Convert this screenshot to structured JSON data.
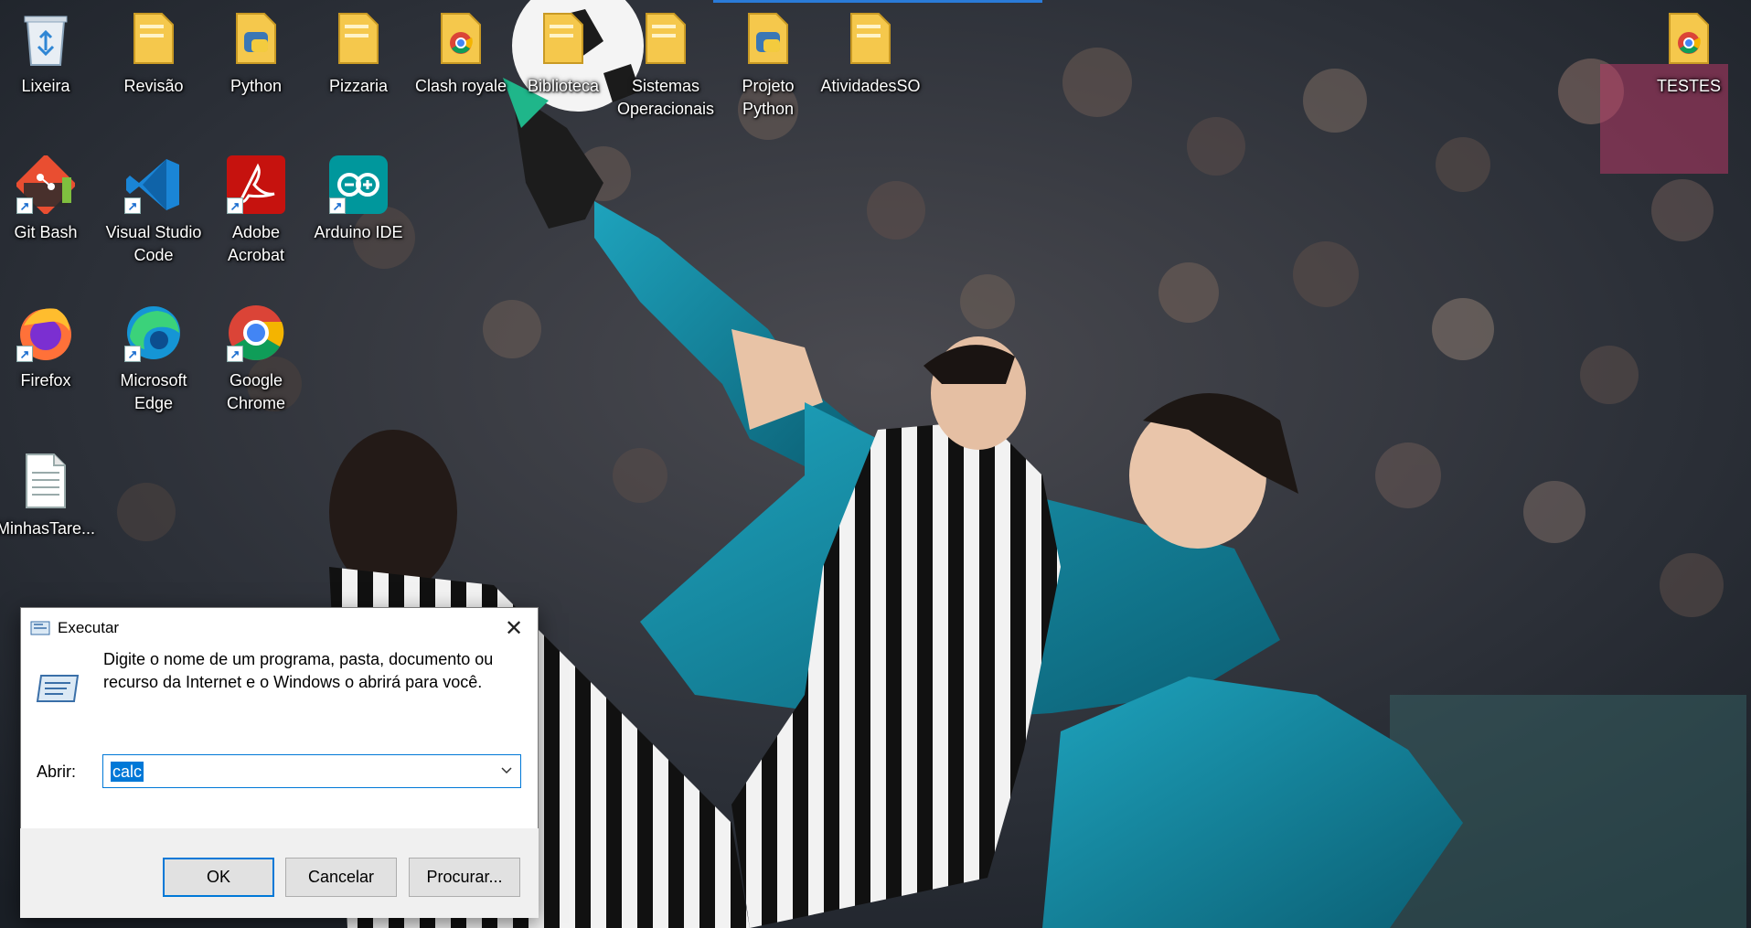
{
  "desktop": {
    "icons": [
      {
        "label": "Lixeira",
        "icon": "recycle-bin-icon"
      },
      {
        "label": "Revisão",
        "icon": "folder-icon"
      },
      {
        "label": "Python",
        "icon": "python-file-icon"
      },
      {
        "label": "Pizzaria",
        "icon": "folder-icon"
      },
      {
        "label": "Clash royale",
        "icon": "chrome-html-file-icon"
      },
      {
        "label": "Biblioteca",
        "icon": "folder-icon"
      },
      {
        "label": "Sistemas Operacionais",
        "icon": "folder-icon"
      },
      {
        "label": "Projeto Python",
        "icon": "python-file-icon"
      },
      {
        "label": "AtividadesSO",
        "icon": "folder-icon"
      },
      {
        "label": "TESTES",
        "icon": "chrome-html-file-icon"
      },
      {
        "label": "Git Bash",
        "icon": "git-bash-icon"
      },
      {
        "label": "Visual Studio Code",
        "icon": "vscode-icon"
      },
      {
        "label": "Adobe Acrobat",
        "icon": "adobe-acrobat-icon"
      },
      {
        "label": "Arduino IDE",
        "icon": "arduino-icon"
      },
      {
        "label": "Firefox",
        "icon": "firefox-icon"
      },
      {
        "label": "Microsoft Edge",
        "icon": "edge-icon"
      },
      {
        "label": "Google Chrome",
        "icon": "chrome-icon"
      },
      {
        "label": "MinhasTare...",
        "icon": "text-file-icon"
      }
    ]
  },
  "run_dialog": {
    "title": "Executar",
    "description": "Digite o nome de um programa, pasta, documento ou recurso da Internet e o Windows o abrirá para você.",
    "open_label": "Abrir:",
    "input_value": "calc",
    "ok_label": "OK",
    "cancel_label": "Cancelar",
    "browse_label": "Procurar...",
    "close_glyph": "✕"
  },
  "colors": {
    "accent": "#0078d7",
    "teal_kit": "#0e7a93",
    "folder_yellow": "#f5c84c"
  }
}
